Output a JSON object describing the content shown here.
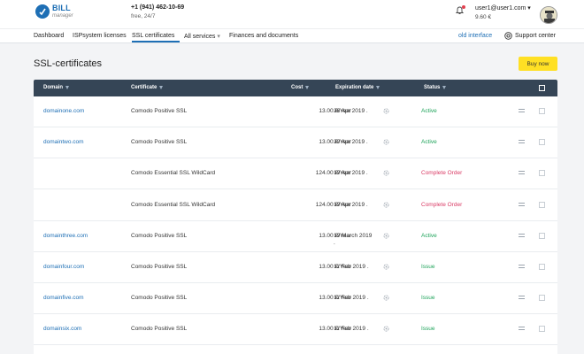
{
  "header": {
    "logo_title": "BILL",
    "logo_subtitle": "manager",
    "phone": "+1 (941) 462-10-69",
    "phone_note": "free, 24/7",
    "user_email": "user1@user1.com",
    "user_dropdown": "▾",
    "balance": "9.60 €"
  },
  "nav": {
    "items": [
      "Dashboard",
      "ISPsystem licenses",
      "SSL certificates",
      "All services",
      "Finances and documents"
    ],
    "all_services_caret": "▾",
    "old_interface": "old interface",
    "support": "Support center"
  },
  "page": {
    "title": "SSL-certificates",
    "buy_button": "Buy now"
  },
  "table": {
    "columns": [
      "Domain",
      "Certificate",
      "Cost",
      "Expiration date",
      "Status"
    ],
    "rows": [
      {
        "domain": "domainone.com",
        "certificate": "Comodo Positive SSL",
        "cost": "13.00 €/Year",
        "expiration": "26 Apr 2019 .",
        "status": "Active",
        "status_type": "active"
      },
      {
        "domain": "domaintwo.com",
        "certificate": "Comodo Positive SSL",
        "cost": "13.00 €/Year",
        "expiration": "20 Apr 2019 .",
        "status": "Active",
        "status_type": "active"
      },
      {
        "domain": "",
        "certificate": "Comodo Essential SSL WildCard",
        "cost": "124.00 €/Year",
        "expiration": "19 Apr 2019 .",
        "status": "Complete Order",
        "status_type": "order"
      },
      {
        "domain": "",
        "certificate": "Comodo Essential SSL WildCard",
        "cost": "124.00 €/Year",
        "expiration": "19 Apr 2019 .",
        "status": "Complete Order",
        "status_type": "order"
      },
      {
        "domain": "domainthree.com",
        "certificate": "Comodo Positive SSL",
        "cost": "13.00 €/Year",
        "expiration": "19 March 2019",
        "expiration_extra": ".",
        "status": "Active",
        "status_type": "active"
      },
      {
        "domain": "domainfour.com",
        "certificate": "Comodo Positive SSL",
        "cost": "13.00 €/Year",
        "expiration": "11 Feb 2019 .",
        "status": "Issue",
        "status_type": "issue"
      },
      {
        "domain": "domainfive.com",
        "certificate": "Comodo Positive SSL",
        "cost": "13.00 €/Year",
        "expiration": "11 Feb 2019 .",
        "status": "Issue",
        "status_type": "issue"
      },
      {
        "domain": "domainsix.com",
        "certificate": "Comodo Positive SSL",
        "cost": "13.00 €/Year",
        "expiration": "11 Feb 2019 .",
        "status": "Issue",
        "status_type": "issue"
      }
    ]
  },
  "colors": {
    "brand": "#1e6fb5",
    "header_bg": "#354556",
    "active": "#1ea35a",
    "complete_order": "#d93a64",
    "buy_button": "#ffe024"
  },
  "icons": [
    "bill-logo-icon",
    "bell-icon",
    "avatar",
    "support-icon",
    "filter-icon",
    "renew-icon",
    "row-menu-icon",
    "checkbox"
  ]
}
